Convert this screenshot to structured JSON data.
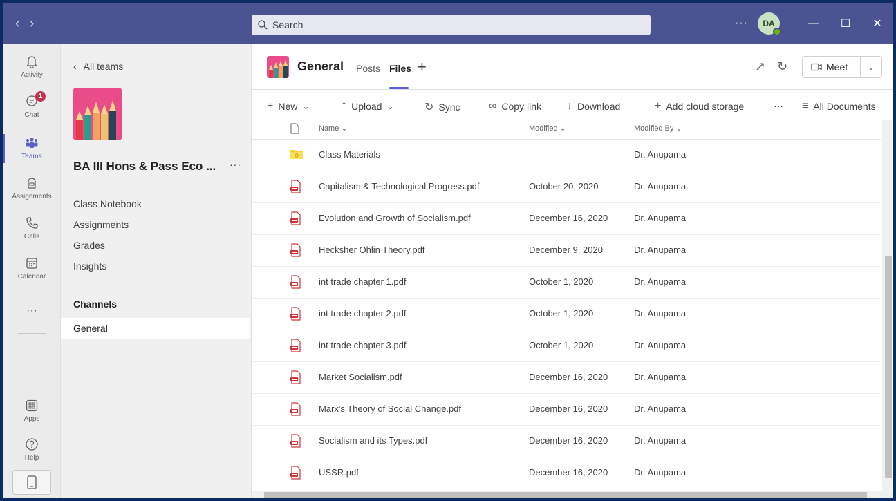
{
  "titlebar": {
    "search_placeholder": "Search",
    "more": "···",
    "avatar_initials": "DA",
    "minimize": "—",
    "maximize": "☐",
    "close": "✕"
  },
  "rail": [
    {
      "label": "Activity",
      "icon": "bell-icon"
    },
    {
      "label": "Chat",
      "icon": "chat-icon",
      "badge": "1"
    },
    {
      "label": "Teams",
      "icon": "teams-icon",
      "active": true
    },
    {
      "label": "Assignments",
      "icon": "assignments-icon"
    },
    {
      "label": "Calls",
      "icon": "phone-icon"
    },
    {
      "label": "Calendar",
      "icon": "calendar-icon"
    },
    {
      "label": "···",
      "icon": "more-icon"
    },
    {
      "label": "Apps",
      "icon": "apps-icon"
    },
    {
      "label": "Help",
      "icon": "help-icon"
    }
  ],
  "team_panel": {
    "back_label": "All teams",
    "team_name": "BA III Hons & Pass Eco ...",
    "more": "···",
    "links": [
      "Class Notebook",
      "Assignments",
      "Grades",
      "Insights"
    ],
    "channels_header": "Channels",
    "channels": [
      "General"
    ]
  },
  "channel": {
    "title": "General",
    "tabs": [
      "Posts",
      "Files"
    ],
    "active_tab": "Files",
    "meet_label": "Meet"
  },
  "toolbar": {
    "new": "New",
    "upload": "Upload",
    "sync": "Sync",
    "copy_link": "Copy link",
    "download": "Download",
    "add_cloud": "Add cloud storage",
    "more": "···",
    "view": "All Documents"
  },
  "table": {
    "headers": {
      "name": "Name",
      "modified": "Modified",
      "modified_by": "Modified By"
    },
    "rows": [
      {
        "type": "folder",
        "name": "Class Materials",
        "modified": "",
        "modified_by": "Dr. Anupama"
      },
      {
        "type": "pdf",
        "name": "Capitalism & Technological Progress.pdf",
        "modified": "October 20, 2020",
        "modified_by": "Dr. Anupama"
      },
      {
        "type": "pdf",
        "name": "Evolution and Growth of Socialism.pdf",
        "modified": "December 16, 2020",
        "modified_by": "Dr. Anupama"
      },
      {
        "type": "pdf",
        "name": "Hecksher Ohlin Theory.pdf",
        "modified": "December 9, 2020",
        "modified_by": "Dr. Anupama"
      },
      {
        "type": "pdf",
        "name": "int trade chapter 1.pdf",
        "modified": "October 1, 2020",
        "modified_by": "Dr. Anupama"
      },
      {
        "type": "pdf",
        "name": "int trade chapter 2.pdf",
        "modified": "October 1, 2020",
        "modified_by": "Dr. Anupama"
      },
      {
        "type": "pdf",
        "name": "int trade chapter 3.pdf",
        "modified": "October 1, 2020",
        "modified_by": "Dr. Anupama"
      },
      {
        "type": "pdf",
        "name": "Market Socialism.pdf",
        "modified": "December 16, 2020",
        "modified_by": "Dr. Anupama"
      },
      {
        "type": "pdf",
        "name": "Marx's Theory of Social Change.pdf",
        "modified": "December 16, 2020",
        "modified_by": "Dr. Anupama"
      },
      {
        "type": "pdf",
        "name": "Socialism and its Types.pdf",
        "modified": "December 16, 2020",
        "modified_by": "Dr. Anupama"
      },
      {
        "type": "pdf",
        "name": "USSR.pdf",
        "modified": "December 16, 2020",
        "modified_by": "Dr. Anupama"
      }
    ]
  },
  "colors": {
    "titlebar": "#4b5392",
    "accent": "#5b5fc7",
    "pdf_red": "#d13438",
    "folder": "#f8d22a",
    "badge": "#c4314b"
  }
}
